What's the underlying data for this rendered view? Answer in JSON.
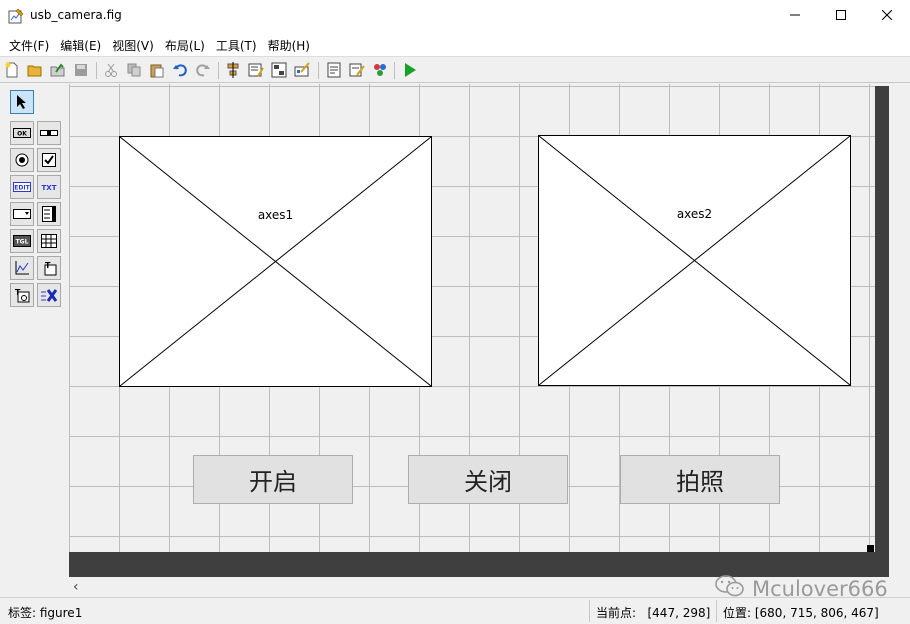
{
  "window": {
    "title": "usb_camera.fig"
  },
  "menu": [
    "文件(F)",
    "编辑(E)",
    "视图(V)",
    "布局(L)",
    "工具(T)",
    "帮助(H)"
  ],
  "toolbar": {
    "icons": [
      "new-file-icon",
      "open-file-icon",
      "save-icon",
      "disabled-save-icon",
      "cut-icon",
      "copy-icon",
      "paste-icon",
      "undo-icon",
      "redo-icon",
      "align-icon",
      "menu-editor-icon",
      "tab-order-icon",
      "toolbar-editor-icon",
      "editor-icon",
      "property-inspector-icon",
      "object-browser-icon",
      "run-icon"
    ]
  },
  "palette": {
    "tools": [
      "select-tool-icon",
      "pushbutton-tool-icon",
      "slider-tool-icon",
      "radio-button-tool-icon",
      "checkbox-tool-icon",
      "edit-text-tool-icon",
      "static-text-tool-icon",
      "popup-menu-tool-icon",
      "listbox-tool-icon",
      "toggle-button-tool-icon",
      "table-tool-icon",
      "axes-tool-icon",
      "panel-tool-icon",
      "button-group-tool-icon",
      "activex-tool-icon"
    ],
    "labels": {
      "pushbutton": "OK",
      "edit": "EDIT",
      "text": "TXT",
      "toggle": "TGL"
    }
  },
  "canvas": {
    "axes": [
      {
        "label": "axes1"
      },
      {
        "label": "axes2"
      }
    ],
    "buttons": [
      {
        "label": "开启"
      },
      {
        "label": "关闭"
      },
      {
        "label": "拍照"
      }
    ]
  },
  "watermark": {
    "text": "Mculover666"
  },
  "status": {
    "tag": "标签: figure1",
    "current_point": "当前点:   [447, 298]",
    "position": "位置: [680, 715, 806, 467]"
  },
  "colors": {
    "run": "#1aa12a",
    "undo": "#1e5fc8",
    "grid": "#bdbdbd"
  }
}
